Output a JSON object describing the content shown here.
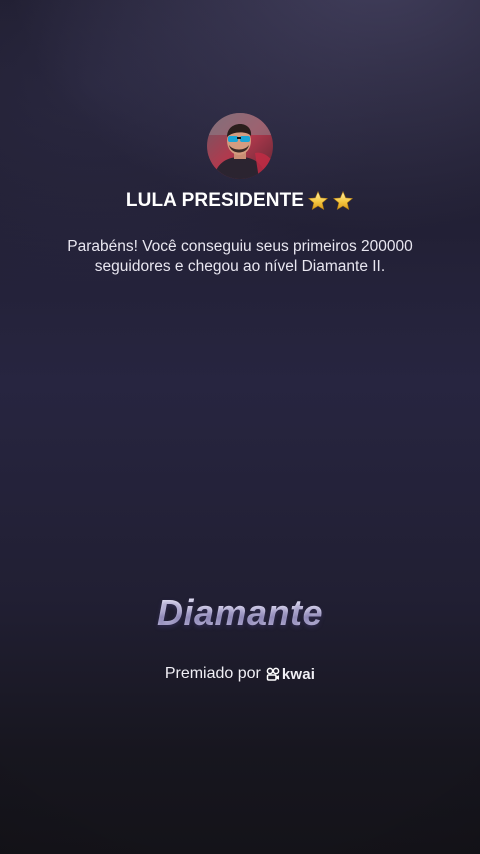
{
  "profile": {
    "username": "LULA PRESIDENTE",
    "badges": [
      "star-icon",
      "star-icon"
    ]
  },
  "achievement": {
    "message": "Parabéns! Você conseguiu seus primeiros 200000 seguidores e chegou ao nível Diamante II.",
    "level": "Diamante"
  },
  "footer": {
    "awarded_by": "Premiado por",
    "brand": "kwai"
  },
  "colors": {
    "background_top": "#1d1b2c",
    "background_bottom": "#141319",
    "star": "#f5c842",
    "level_text": "#cfcbe6"
  }
}
